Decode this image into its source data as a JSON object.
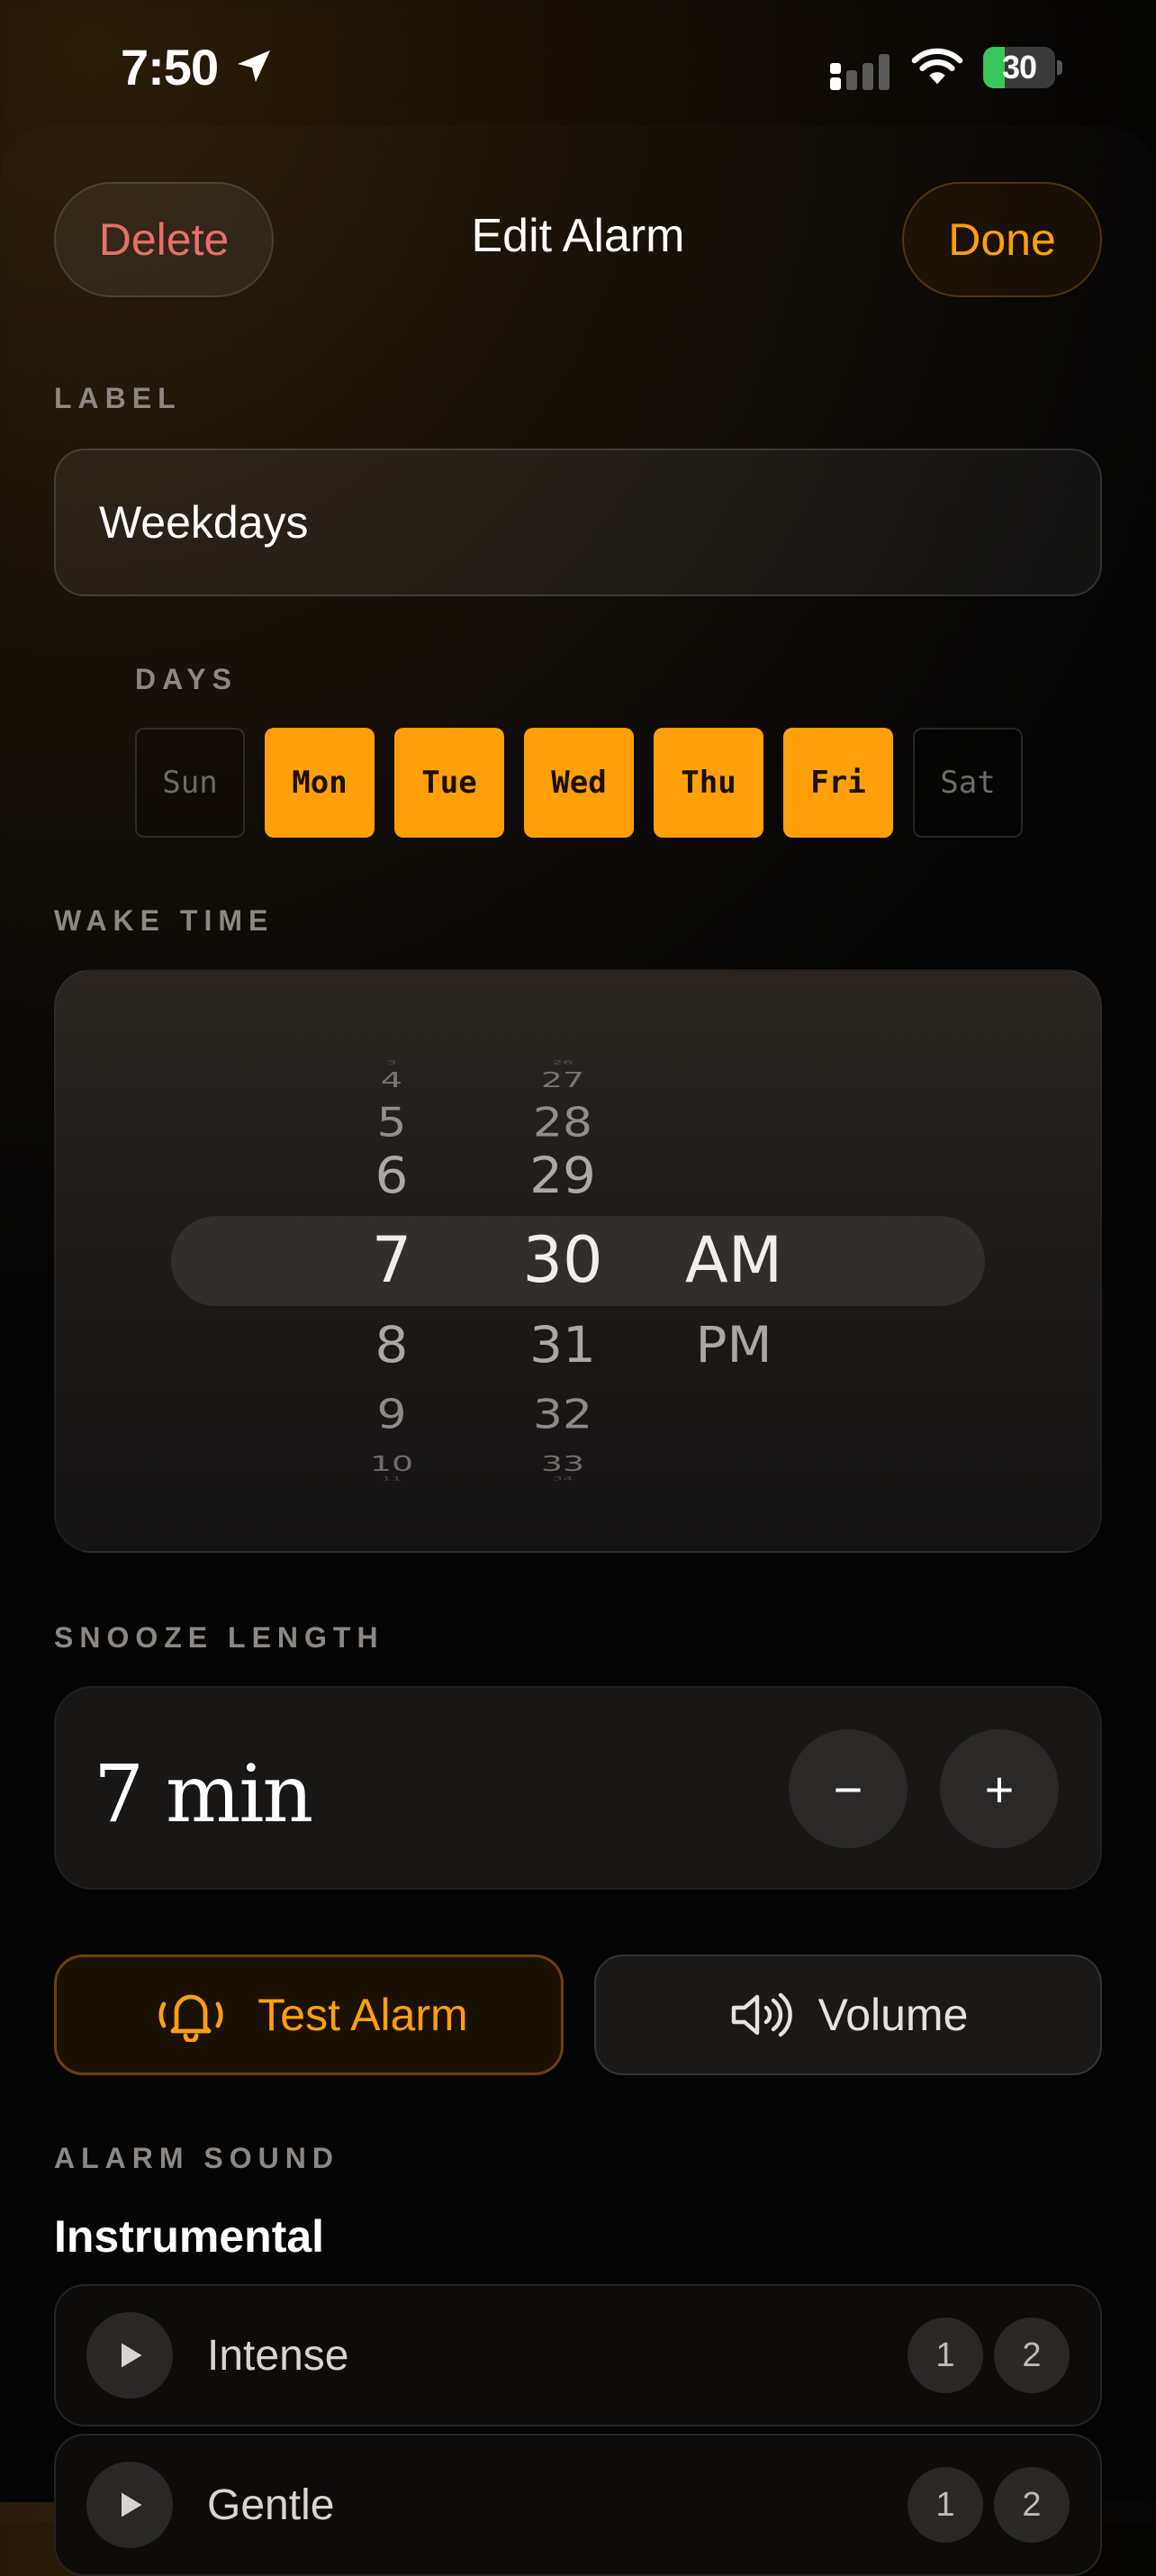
{
  "status_bar": {
    "time": "7:50",
    "battery": "30",
    "battery_level": 0.3
  },
  "header": {
    "delete_label": "Delete",
    "title": "Edit Alarm",
    "done_label": "Done"
  },
  "label_section": {
    "title": "LABEL",
    "value": "Weekdays"
  },
  "days_section": {
    "title": "DAYS",
    "days": [
      {
        "label": "Sun",
        "selected": false
      },
      {
        "label": "Mon",
        "selected": true
      },
      {
        "label": "Tue",
        "selected": true
      },
      {
        "label": "Wed",
        "selected": true
      },
      {
        "label": "Thu",
        "selected": true
      },
      {
        "label": "Fri",
        "selected": true
      },
      {
        "label": "Sat",
        "selected": false
      }
    ]
  },
  "wake_time": {
    "title": "WAKE TIME",
    "hour_options": [
      "3",
      "4",
      "5",
      "6",
      "7",
      "8",
      "9",
      "10",
      "11"
    ],
    "minute_options": [
      "26",
      "27",
      "28",
      "29",
      "30",
      "31",
      "32",
      "33",
      "34"
    ],
    "period_options": [
      "AM",
      "PM"
    ],
    "selected_hour": "7",
    "selected_minute": "30",
    "selected_period": "AM"
  },
  "snooze": {
    "title": "SNOOZE LENGTH",
    "value": "7 min",
    "minus_label": "−",
    "plus_label": "+"
  },
  "actions": {
    "test_label": "Test Alarm",
    "volume_label": "Volume"
  },
  "alarm_sound": {
    "title": "ALARM SOUND",
    "group": "Instrumental",
    "items": [
      {
        "name": "Intense",
        "badges": [
          "1",
          "2"
        ]
      },
      {
        "name": "Gentle",
        "badges": [
          "1",
          "2"
        ]
      }
    ]
  },
  "colors": {
    "accent": "#ff9f0a",
    "delete": "#e7706a",
    "battery": "#34c759"
  }
}
